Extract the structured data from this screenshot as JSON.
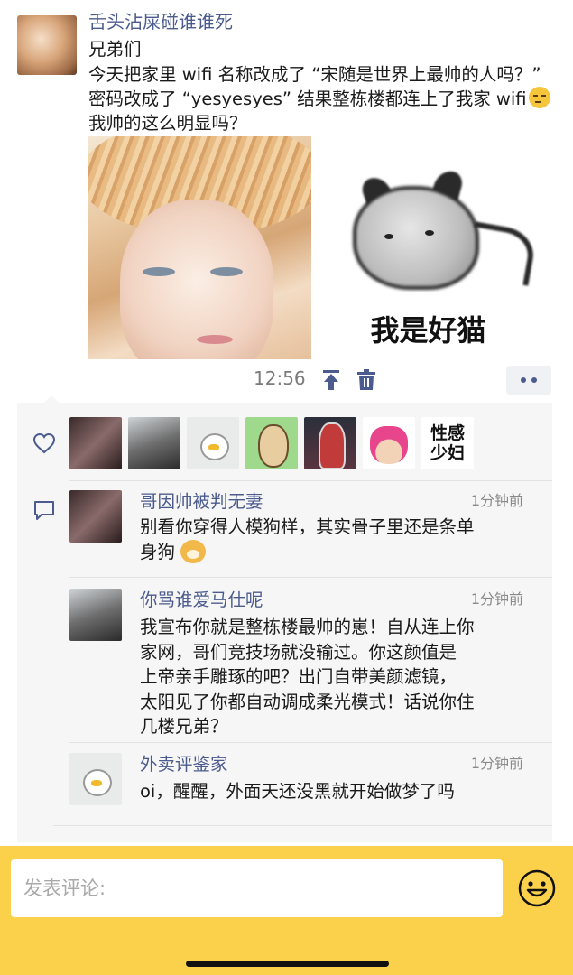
{
  "post": {
    "author": "舌头沾屎碰谁谁死",
    "lines": [
      "兄弟们",
      "今天把家里 wifi 名称改成了 “宋随是世界上最帅的人吗？”",
      "密码改成了 “yesyesyes” 结果整栋楼都连上了我家 wifi",
      "我帅的这么明显吗？"
    ],
    "inline_emoji": "raised-eyebrow-emoji",
    "images": [
      {
        "name": "portrait-photo",
        "caption": ""
      },
      {
        "name": "cat-meme",
        "caption": "我是好猫"
      }
    ],
    "time": "12:56"
  },
  "likes": {
    "icon": "heart-icon",
    "avatars": [
      {
        "name": "liker-avatar-1"
      },
      {
        "name": "liker-avatar-2"
      },
      {
        "name": "liker-avatar-3",
        "text": ""
      },
      {
        "name": "liker-avatar-4"
      },
      {
        "name": "liker-avatar-5"
      },
      {
        "name": "liker-avatar-6"
      },
      {
        "name": "liker-avatar-7",
        "text_line1": "性感",
        "text_line2": "少妇"
      }
    ]
  },
  "comments": [
    {
      "name": "哥因帅被判无妻",
      "time": "1分钟前",
      "lines": [
        "别看你穿得人模狗样，其实骨子里还是条单",
        "身狗"
      ]
    },
    {
      "name": "你骂谁爱马仕呢",
      "time": "1分钟前",
      "lines": [
        "我宣布你就是整栋楼最帅的崽！自从连上你",
        "家网，哥们竞技场就没输过。你这颜值是",
        "上帝亲手雕琢的吧？出门自带美颜滤镜，",
        "太阳见了你都自动调成柔光模式！话说你住",
        "几楼兄弟？"
      ]
    },
    {
      "name": "外卖评鉴家",
      "time": "1分钟前",
      "lines": [
        "oi，醒醒，外面天还没黑就开始做梦了吗"
      ]
    }
  ],
  "composer": {
    "placeholder": "发表评论:",
    "emoji_button": "smiley-icon"
  },
  "colors": {
    "link_blue": "#4b5b8e",
    "bar_yellow": "#fbd14b",
    "panel_gray": "#f6f6f6"
  }
}
